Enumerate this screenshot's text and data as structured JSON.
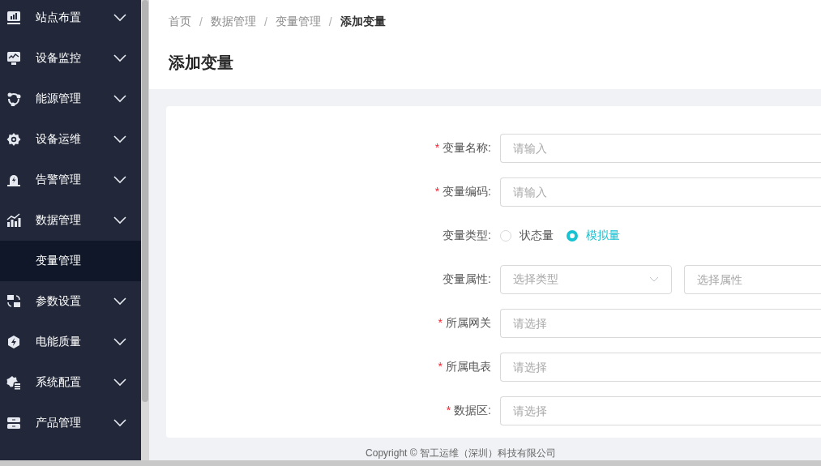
{
  "sidebar": {
    "items": [
      {
        "label": "站点布置"
      },
      {
        "label": "设备监控"
      },
      {
        "label": "能源管理"
      },
      {
        "label": "设备运维"
      },
      {
        "label": "告警管理"
      },
      {
        "label": "数据管理",
        "children": [
          {
            "label": "变量管理",
            "selected": true
          }
        ]
      },
      {
        "label": "参数设置"
      },
      {
        "label": "电能质量"
      },
      {
        "label": "系统配置"
      },
      {
        "label": "产品管理"
      }
    ]
  },
  "breadcrumb": [
    {
      "label": "首页",
      "current": false
    },
    {
      "label": "数据管理",
      "current": false
    },
    {
      "label": "变量管理",
      "current": false
    },
    {
      "label": "添加变量",
      "current": true
    }
  ],
  "breadcrumb_separator": "/",
  "page_title": "添加变量",
  "form": {
    "fields": [
      {
        "kind": "input",
        "label": "变量名称:",
        "required": true,
        "placeholder": "请输入"
      },
      {
        "kind": "input",
        "label": "变量编码:",
        "required": true,
        "placeholder": "请输入"
      },
      {
        "kind": "radio",
        "label": "变量类型:",
        "required": false,
        "options": [
          {
            "label": "状态量",
            "selected": false
          },
          {
            "label": "模拟量",
            "selected": true
          }
        ]
      },
      {
        "kind": "select-pair",
        "label": "变量属性:",
        "required": false,
        "placeholders": [
          "选择类型",
          "选择属性"
        ]
      },
      {
        "kind": "input",
        "label": "所属网关",
        "required": true,
        "placeholder": "请选择"
      },
      {
        "kind": "input",
        "label": "所属电表",
        "required": true,
        "placeholder": "请选择"
      },
      {
        "kind": "input",
        "label": "数据区:",
        "required": true,
        "placeholder": "请选择"
      }
    ]
  },
  "required_mark": "*",
  "footer": "Copyright © 智工运维（深圳）科技有限公司"
}
